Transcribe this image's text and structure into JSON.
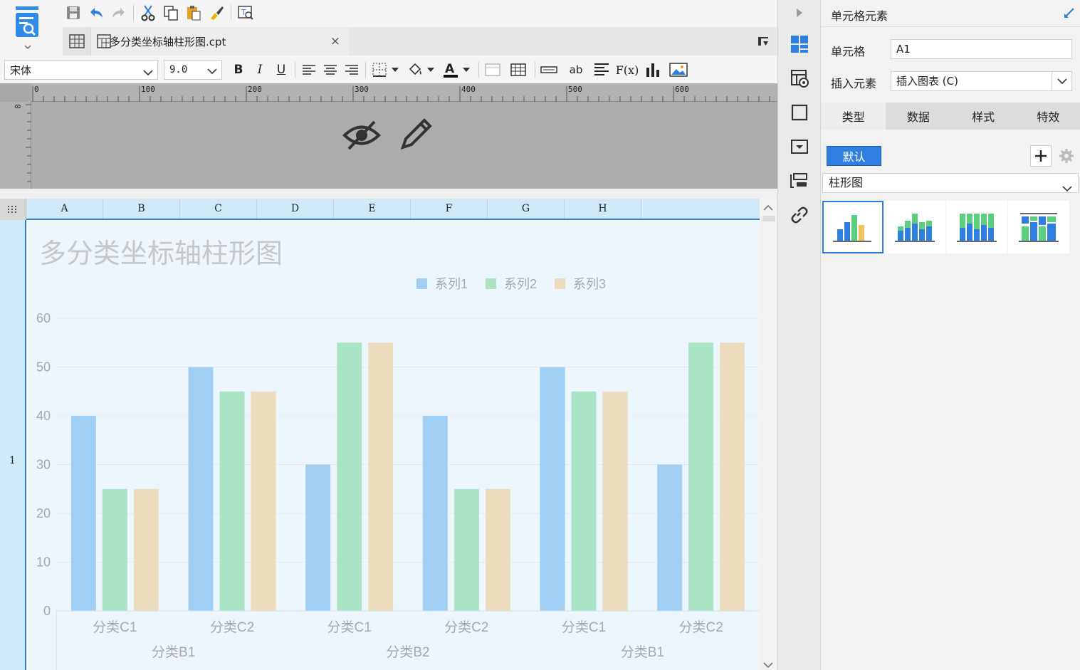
{
  "colors": {
    "accent": "#2f7fe0",
    "series1": "#9fcff5",
    "series2": "#a9e4c6",
    "series3": "#ebdcbc",
    "axis_text": "#a7a7a7"
  },
  "file_tab": {
    "title": "多分类坐标轴柱形图.cpt",
    "close": "×"
  },
  "format": {
    "font_name": "宋体",
    "font_size": "9.0",
    "bold": "B",
    "italic": "I",
    "underline": "U",
    "ab": "ab",
    "fx": "F(x)"
  },
  "ruler": {
    "ticks": [
      "0",
      "100",
      "200",
      "300",
      "400",
      "500",
      "600"
    ],
    "v_zero": "0"
  },
  "sheet": {
    "columns": [
      "A",
      "B",
      "C",
      "D",
      "E",
      "F",
      "G",
      "H"
    ],
    "rows": [
      "1"
    ]
  },
  "chart_data": {
    "type": "bar",
    "title": "多分类坐标轴柱形图",
    "categories": [
      "分类C1",
      "分类C2",
      "分类C1",
      "分类C2",
      "分类C1",
      "分类C2"
    ],
    "groups": [
      "分类B1",
      "分类B2",
      "分类B1"
    ],
    "series": [
      {
        "name": "系列1",
        "values": [
          40,
          50,
          30,
          40,
          50,
          30
        ]
      },
      {
        "name": "系列2",
        "values": [
          25,
          45,
          55,
          25,
          45,
          55
        ]
      },
      {
        "name": "系列3",
        "values": [
          25,
          45,
          55,
          25,
          45,
          55
        ]
      }
    ],
    "yticks": [
      "0",
      "10",
      "20",
      "30",
      "40",
      "50",
      "60"
    ],
    "ylim": [
      0,
      60
    ],
    "legend_position": "top-right",
    "grid": true
  },
  "panel": {
    "title": "单元格元素",
    "cell_label": "单元格",
    "cell_value": "A1",
    "insert_label": "插入元素",
    "insert_value": "插入图表 (C)",
    "tabs": [
      "类型",
      "数据",
      "样式",
      "特效"
    ],
    "default_button": "默认",
    "chart_type": "柱形图"
  }
}
